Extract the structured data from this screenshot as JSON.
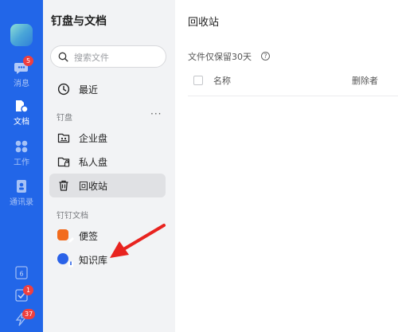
{
  "rail": {
    "messages_label": "消息",
    "messages_badge": "5",
    "docs_label": "文档",
    "work_label": "工作",
    "contacts_label": "通讯录",
    "calendar_day": "6",
    "todo_badge": "1",
    "ding_badge": "37"
  },
  "sidebar": {
    "title": "钉盘与文档",
    "search_placeholder": "搜索文件",
    "recent": "最近",
    "section_disk": "钉盘",
    "more": "···",
    "enterprise_disk": "企业盘",
    "personal_disk": "私人盘",
    "recycle_bin": "回收站",
    "section_docs": "钉钉文档",
    "notes": "便签",
    "knowledge_base": "知识库"
  },
  "main": {
    "title": "回收站",
    "retention_note": "文件仅保留30天",
    "help": "?",
    "col_name": "名称",
    "col_deleter": "删除者"
  },
  "colors": {
    "rail_bg": "#2266e8",
    "sidebar_bg": "#f2f3f5",
    "active_bg": "#e0e1e4",
    "arrow": "#e8231f",
    "notes_icon": "#f26b1d",
    "kb_icon": "#2a62e8"
  }
}
